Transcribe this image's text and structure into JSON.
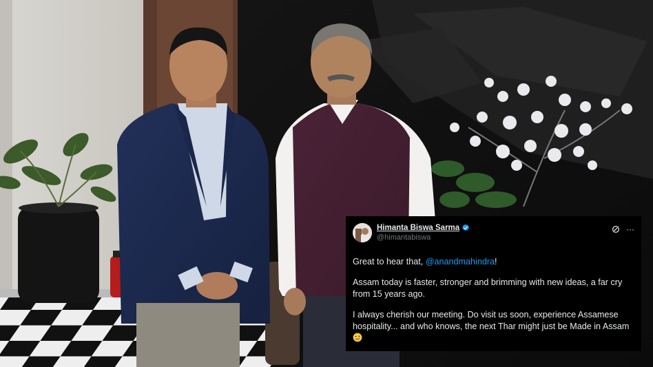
{
  "tweet": {
    "author_name": "Himanta Biswa Sarma",
    "handle": "@himantabiswa",
    "line1_prefix": "Great to hear that, ",
    "line1_mention": "@anandmahindra",
    "line1_suffix": "!",
    "paragraph2": "Assam today is faster, stronger and brimming with new ideas, a far cry from 15 years ago.",
    "paragraph3": "I always cherish our meeting. Do visit us soon, experience Assamese hospitality... and who knows, the next Thar might just be Made in Assam",
    "more_glyph": "···"
  },
  "colors": {
    "accent": "#1d9bf0",
    "tweet_bg": "#000000",
    "text": "#e7e9ea",
    "muted": "#71767b"
  },
  "icons": [
    "verified-badge-icon",
    "grok-icon",
    "more-icon",
    "winking-face-emoji"
  ]
}
